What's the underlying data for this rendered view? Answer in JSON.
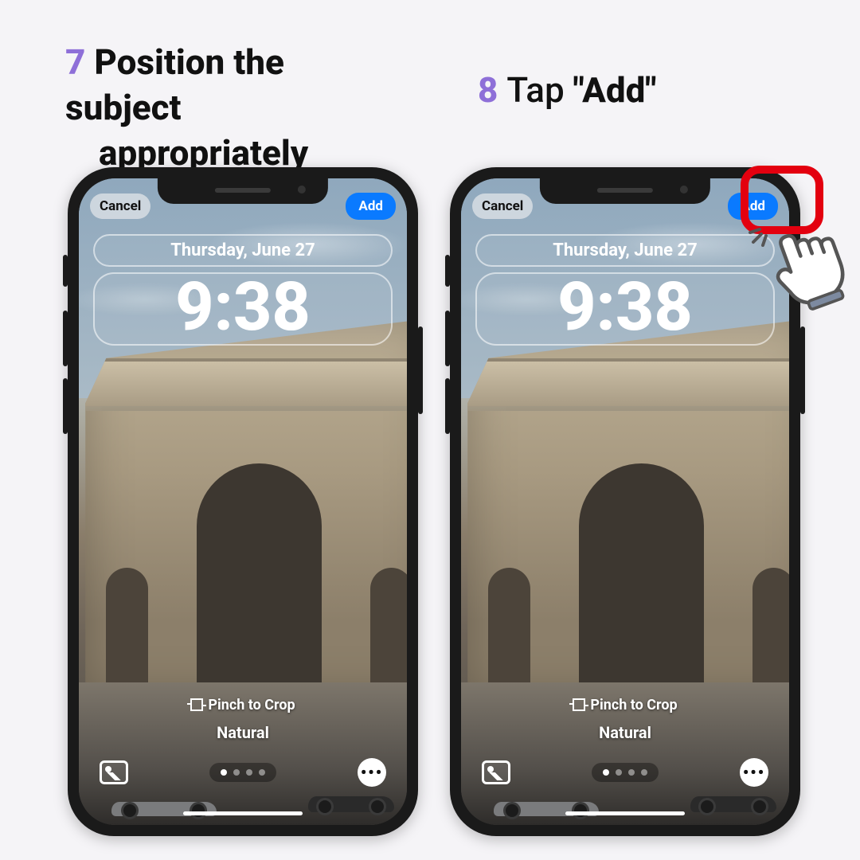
{
  "steps": {
    "s7": {
      "num": "7",
      "line1": "Position the subject",
      "line2": "appropriately"
    },
    "s8": {
      "num": "8",
      "prefix": "Tap ",
      "q1": "\"",
      "bold": "Add",
      "q2": "\""
    }
  },
  "lockscreen": {
    "cancel": "Cancel",
    "add": "Add",
    "date": "Thursday, June 27",
    "time": "9:38",
    "pinch": "Pinch to Crop",
    "style": "Natural",
    "more": "•••"
  },
  "colors": {
    "accent_purple": "#8e6fd8",
    "ios_blue": "#0a7aff",
    "highlight_red": "#e3000f"
  }
}
